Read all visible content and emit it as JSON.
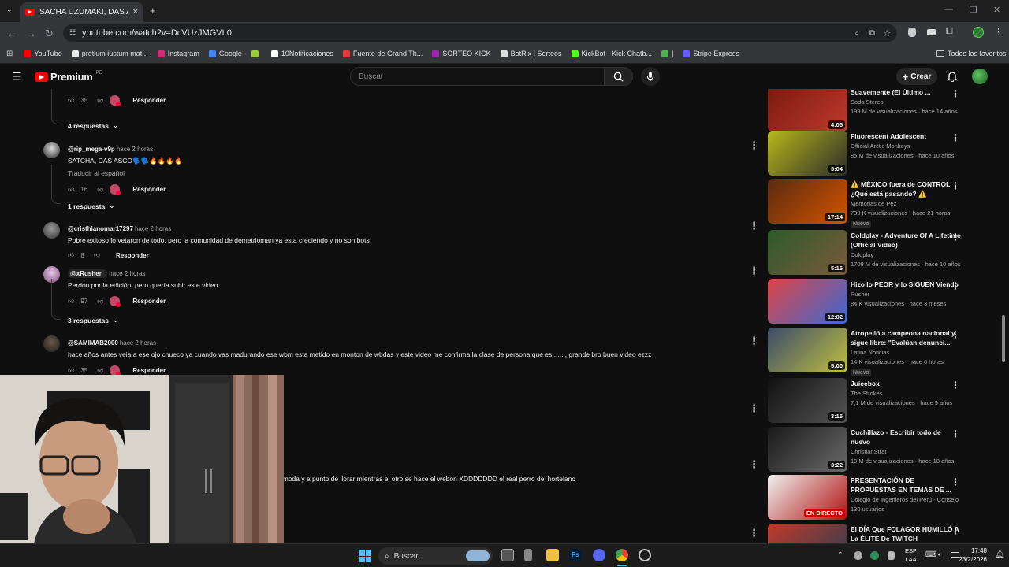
{
  "browser": {
    "tab_title": "SACHA UZUMAKI, DAS ASCO -",
    "url": "youtube.com/watch?v=DcVUzJMGVL0",
    "bookmarks": [
      {
        "label": "YouTube",
        "color": "#ff0000"
      },
      {
        "label": "pretium iustum mat...",
        "color": "#e8e8e8"
      },
      {
        "label": "Instagram",
        "color": "#d62976"
      },
      {
        "label": "Google",
        "color": "#4285f4"
      },
      {
        "label": "",
        "color": "#9acd32"
      },
      {
        "label": "10Notificaciones",
        "color": "#ffffff"
      },
      {
        "label": "Fuente de Grand Th...",
        "color": "#e53935"
      },
      {
        "label": "SORTEO KICK",
        "color": "#9c27b0"
      },
      {
        "label": "BotRix | Sorteos",
        "color": "#dddddd"
      },
      {
        "label": "KickBot - Kick Chatb...",
        "color": "#53fc18"
      },
      {
        "label": "|",
        "color": "#4caf50"
      },
      {
        "label": "Stripe Express",
        "color": "#635bff"
      }
    ],
    "all_bookmarks": "Todos los favoritos"
  },
  "header": {
    "logo": "Premium",
    "region": "PE",
    "search_placeholder": "Buscar",
    "create_label": "Crear"
  },
  "comments": [
    {
      "likes": "35",
      "reply": "Responder",
      "replies": "4 respuestas"
    },
    {
      "handle": "@rip_mega-v9p",
      "time": "hace 2 horas",
      "text": "SATCHA, DAS ASCO🗣️🗣️🔥🔥🔥🔥",
      "translate": "Traducir al español",
      "likes": "16",
      "reply": "Responder",
      "replies": "1 respuesta"
    },
    {
      "handle": "@cristhianomar17297",
      "time": "hace 2 horas",
      "text": "Pobre exitoso lo vetaron de todo, pero la comunidad de demetrioman ya esta creciendo y no son bots",
      "likes": "8",
      "reply": "Responder"
    },
    {
      "handle": "@xRusher_",
      "time": "hace 2 horas",
      "text": "Perdón por la edición, pero quería subir este video",
      "likes": "97",
      "reply": "Responder",
      "replies": "3 respuestas"
    },
    {
      "handle": "@SAMIMAB2000",
      "time": "hace 2 horas",
      "text": "hace años antes veia a ese ojo chueco ya cuando vas madurando ese wbm esta metido en monton de wbdas y este video me confirma la clase de persona que es  ..... , grande bro buen video ezzz",
      "likes": "35",
      "reply": "Responder"
    },
    {
      "text": "omoda y a punto de llorar mientras el otro se hace el webon XDDDDDDD el real perro del hortelano"
    }
  ],
  "sidebar": [
    {
      "title": "Suavemente (El Último ...",
      "channel": "Soda Stereo",
      "meta": "199 M de visualizaciones · hace 14 años",
      "duration": "4:05",
      "c1": "#7a1a10",
      "c2": "#c0392b"
    },
    {
      "title": "Fluorescent Adolescent",
      "channel": "Official Arctic Monkeys",
      "meta": "85 M de visualizaciones · hace 10 años",
      "duration": "3:04",
      "c1": "#b8b81a",
      "c2": "#2b2b2b"
    },
    {
      "title": "⚠️ MÉXICO fuera de CONTROL ¿Qué está pasando? ⚠️",
      "channel": "Memorias de Pez",
      "meta": "739 K visualizaciones · hace 21 horas",
      "badge": "Nuevo",
      "duration": "17:14",
      "c1": "#5a2a10",
      "c2": "#d35400"
    },
    {
      "title": "Coldplay - Adventure Of A Lifetime (Official Video)",
      "channel": "Coldplay",
      "meta": "1709 M de visualizaciones · hace 10 años",
      "duration": "5:16",
      "c1": "#2e5a2a",
      "c2": "#7a5a3a"
    },
    {
      "title": "Hizo lo PEOR y lo SIGUEN Viendo",
      "channel": "Rusher",
      "meta": "84 K visualizaciones · hace 3 meses",
      "duration": "12:02",
      "c1": "#d44",
      "c2": "#3a6ad4"
    },
    {
      "title": "Atropelló a campeona nacional y sigue libre: \"Evalúan denunci...",
      "channel": "Latina Noticias",
      "meta": "14 K visualizaciones · hace 6 horas",
      "badge": "Nuevo",
      "duration": "5:00",
      "c1": "#3a4a6a",
      "c2": "#c0c040"
    },
    {
      "title": "Juicebox",
      "channel": "The Strokes",
      "meta": "7,1 M de visualizaciones · hace 9 años",
      "duration": "3:15",
      "c1": "#111111",
      "c2": "#555555"
    },
    {
      "title": "Cuchillazo - Escribir todo de nuevo",
      "channel": "ChristianStrat",
      "meta": "10 M de visualizaciones · hace 18 años",
      "duration": "3:22",
      "c1": "#1a1a1a",
      "c2": "#6a6a6a"
    },
    {
      "title": "PRESENTACIÓN DE PROPUESTAS EN TEMAS DE ...",
      "channel": "Colegio de Ingenieros del Perú - Consejo ...",
      "meta": "130 usuarios",
      "duration": "EN DIRECTO",
      "live": true,
      "c1": "#f0f0f0",
      "c2": "#b01010"
    },
    {
      "title": "El DÍA Que FOLAGOR HUMILLÓ A La ÉLITE De TWITCH",
      "channel": "",
      "meta": "",
      "duration": "",
      "c1": "#c0392b",
      "c2": "#2c3e50"
    }
  ],
  "taskbar": {
    "search": "Buscar",
    "lang1": "ESP",
    "lang2": "LAA",
    "time": "17:48",
    "date": "23/2/2026"
  }
}
